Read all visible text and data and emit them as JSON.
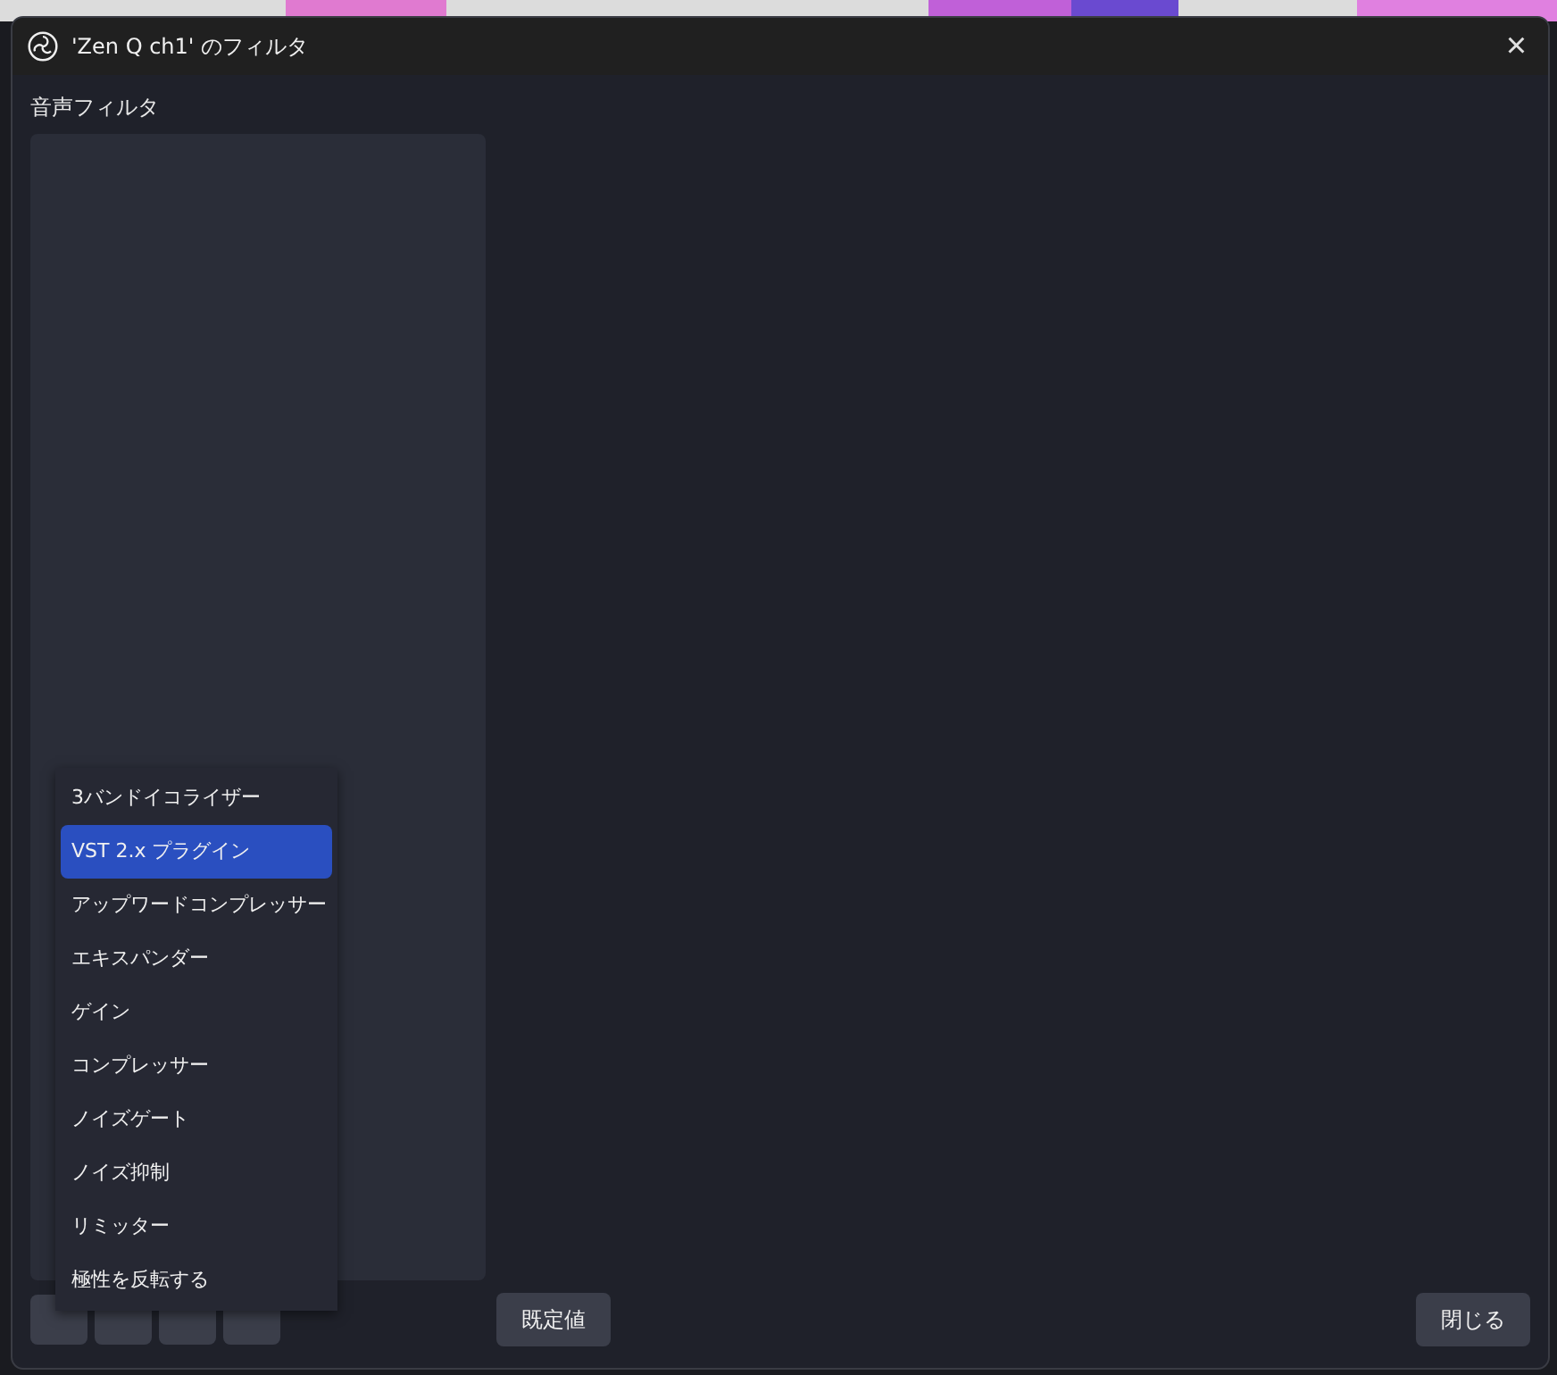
{
  "window": {
    "title": "'Zen Q ch1' のフィルタ",
    "close": "×"
  },
  "section_label": "音声フィルタ",
  "add_menu": {
    "items": [
      {
        "label": "3バンドイコライザー",
        "selected": false
      },
      {
        "label": "VST 2.x プラグイン",
        "selected": true
      },
      {
        "label": "アップワードコンプレッサー",
        "selected": false
      },
      {
        "label": "エキスパンダー",
        "selected": false
      },
      {
        "label": "ゲイン",
        "selected": false
      },
      {
        "label": "コンプレッサー",
        "selected": false
      },
      {
        "label": "ノイズゲート",
        "selected": false
      },
      {
        "label": "ノイズ抑制",
        "selected": false
      },
      {
        "label": "リミッター",
        "selected": false
      },
      {
        "label": "極性を反転する",
        "selected": false
      }
    ]
  },
  "buttons": {
    "defaults": "既定値",
    "close": "閉じる"
  }
}
